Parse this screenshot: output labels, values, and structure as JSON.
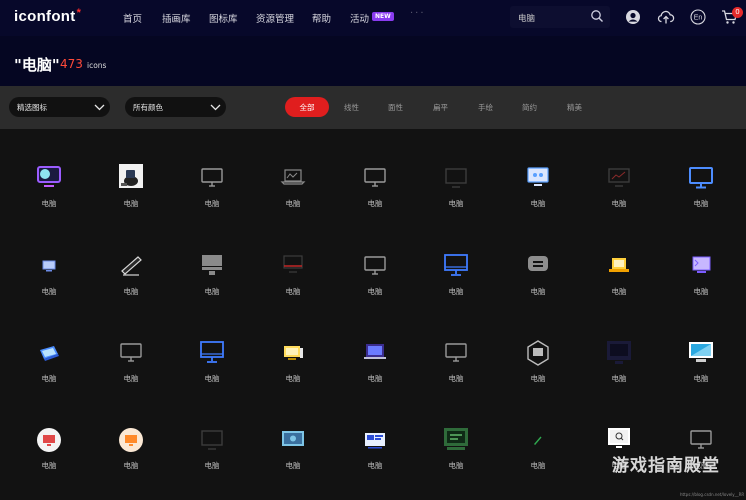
{
  "brand": {
    "name": "iconfont",
    "star": "*"
  },
  "nav": {
    "items": [
      "首页",
      "插画库",
      "图标库",
      "资源管理",
      "帮助",
      "活动"
    ],
    "new_badge": "NEW",
    "more": "···"
  },
  "search": {
    "value": "电脑"
  },
  "header_icons": {
    "user": "user-circle-icon",
    "upload": "cloud-upload-icon",
    "language": "En",
    "cart": "cart-icon",
    "cart_count": "0"
  },
  "title": {
    "query": "\"电脑\"",
    "count": "473",
    "unit": "icons"
  },
  "filters": {
    "select_icons": "精选图标",
    "select_colors": "所有颜色",
    "tabs": [
      "全部",
      "线性",
      "面性",
      "扁平",
      "手绘",
      "简约",
      "精美"
    ],
    "active_tab": "全部"
  },
  "grid": {
    "items": [
      {
        "label": "电脑",
        "icon": "monitor-purple-icon"
      },
      {
        "label": "电脑",
        "icon": "computer-photo-icon"
      },
      {
        "label": "电脑",
        "icon": "monitor-outline-icon"
      },
      {
        "label": "电脑",
        "icon": "laptop-chart-icon"
      },
      {
        "label": "电脑",
        "icon": "monitor-outline-icon"
      },
      {
        "label": "电脑",
        "icon": "monitor-dark-icon"
      },
      {
        "label": "电脑",
        "icon": "monitor-face-icon"
      },
      {
        "label": "电脑",
        "icon": "monitor-chart-red-icon"
      },
      {
        "label": "电脑",
        "icon": "monitor-blue-icon"
      },
      {
        "label": "电脑",
        "icon": "monitor-small-blue-icon"
      },
      {
        "label": "电脑",
        "icon": "monitor-tilted-icon"
      },
      {
        "label": "电脑",
        "icon": "monitor-filled-icon"
      },
      {
        "label": "电脑",
        "icon": "laptop-red-icon"
      },
      {
        "label": "电脑",
        "icon": "monitor-outline-icon"
      },
      {
        "label": "电脑",
        "icon": "monitor-blue-outline-icon"
      },
      {
        "label": "电脑",
        "icon": "monitor-rounded-icon"
      },
      {
        "label": "电脑",
        "icon": "monitor-yellow-icon"
      },
      {
        "label": "电脑",
        "icon": "monitor-purple-small-icon"
      },
      {
        "label": "电脑",
        "icon": "laptop-iso-icon"
      },
      {
        "label": "电脑",
        "icon": "monitor-outline-icon"
      },
      {
        "label": "电脑",
        "icon": "monitor-blue-outline-icon"
      },
      {
        "label": "电脑",
        "icon": "monitor-yellow-stack-icon"
      },
      {
        "label": "电脑",
        "icon": "laptop-purple-icon"
      },
      {
        "label": "电脑",
        "icon": "monitor-outline-icon"
      },
      {
        "label": "电脑",
        "icon": "hexagon-monitor-icon"
      },
      {
        "label": "电脑",
        "icon": "monitor-navy-icon"
      },
      {
        "label": "电脑",
        "icon": "monitor-sky-icon"
      },
      {
        "label": "电脑",
        "icon": "monitor-circle-red-icon"
      },
      {
        "label": "电脑",
        "icon": "monitor-circle-orange-icon"
      },
      {
        "label": "电脑",
        "icon": "monitor-dark-icon"
      },
      {
        "label": "电脑",
        "icon": "monitor-teal-icon"
      },
      {
        "label": "电脑",
        "icon": "monitor-card-blue-icon"
      },
      {
        "label": "电脑",
        "icon": "monitor-green-icon"
      },
      {
        "label": "电脑",
        "icon": "pen-green-icon"
      },
      {
        "label": "电脑",
        "icon": "monitor-white-icon"
      },
      {
        "label": "电脑",
        "icon": "monitor-outline-icon"
      }
    ]
  },
  "watermark": "游戏指南殿堂",
  "footer_url": "https://blog.csdn.net/lovely__RR"
}
